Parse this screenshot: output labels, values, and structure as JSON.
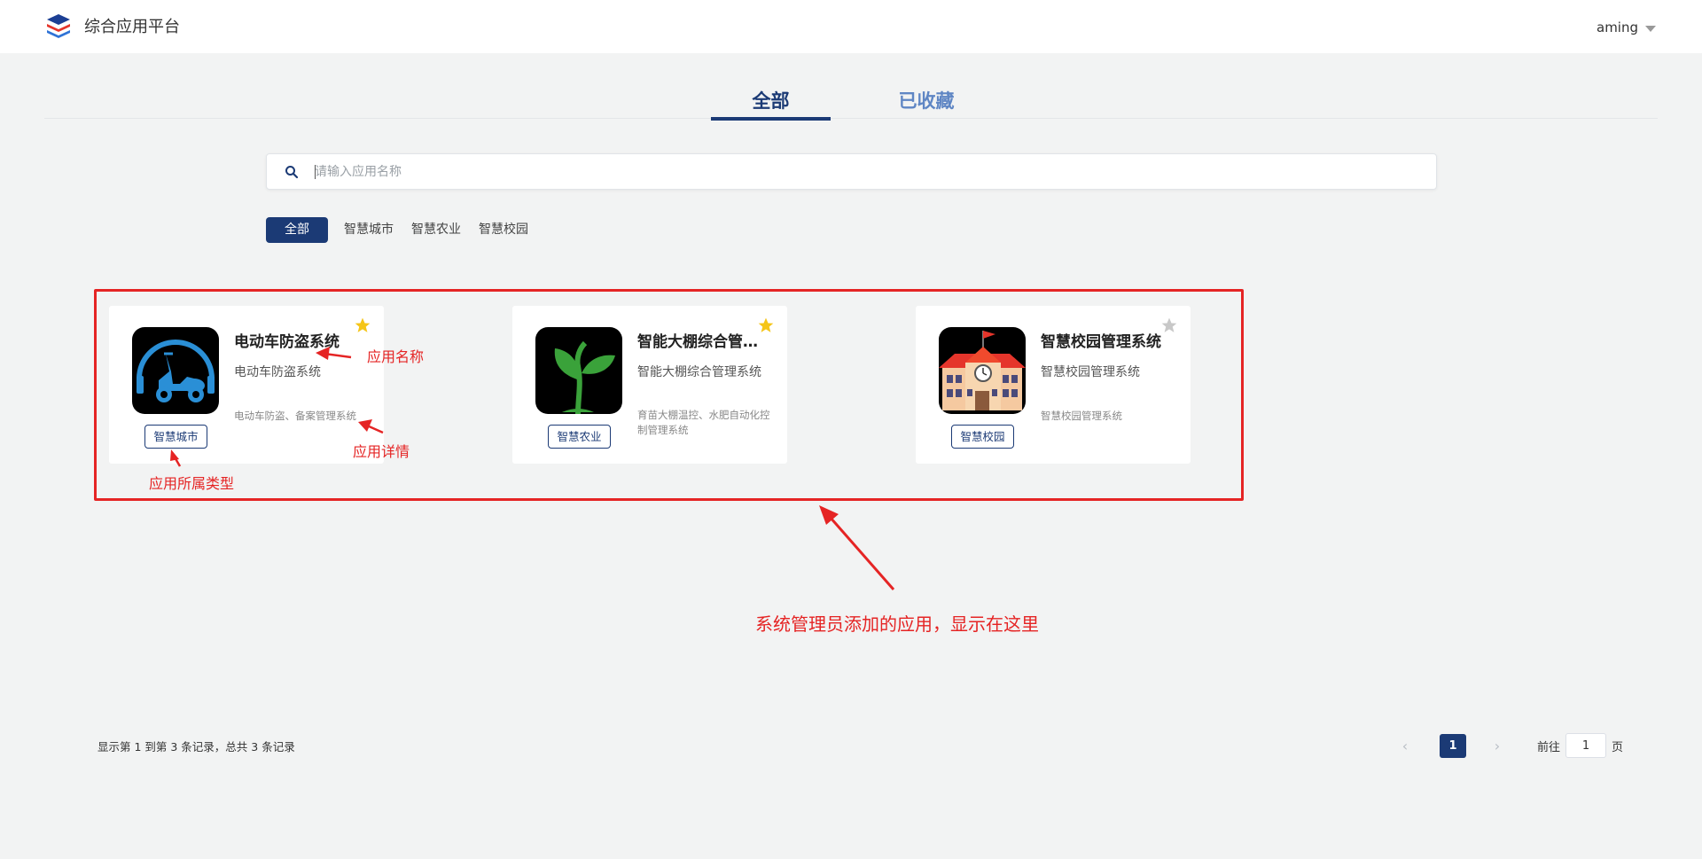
{
  "header": {
    "title": "综合应用平台",
    "user": "aming"
  },
  "tabs": [
    {
      "label": "全部",
      "active": true
    },
    {
      "label": "已收藏",
      "active": false
    }
  ],
  "search": {
    "placeholder": "请输入应用名称",
    "value": ""
  },
  "filters": [
    {
      "label": "全部",
      "active": true
    },
    {
      "label": "智慧城市",
      "active": false
    },
    {
      "label": "智慧农业",
      "active": false
    },
    {
      "label": "智慧校园",
      "active": false
    }
  ],
  "apps": [
    {
      "name": "电动车防盗系统",
      "subname": "电动车防盗系统",
      "desc": "电动车防盗、备案管理系统",
      "tag": "智慧城市",
      "favorited": true,
      "icon": "electric-scooter-icon"
    },
    {
      "name": "智能大棚综合管理系统",
      "subname": "智能大棚综合管理系统",
      "desc": "育苗大棚温控、水肥自动化控制管理系统",
      "tag": "智慧农业",
      "favorited": true,
      "icon": "seedling-icon"
    },
    {
      "name": "智慧校园管理系统",
      "subname": "智慧校园管理系统",
      "desc": "智慧校园管理系统",
      "tag": "智慧校园",
      "favorited": false,
      "icon": "school-building-icon"
    }
  ],
  "annotations": {
    "app_name": "应用名称",
    "app_detail": "应用详情",
    "app_type": "应用所属类型",
    "main_note": "系统管理员添加的应用，显示在这里",
    "color": "#e52424"
  },
  "footer": {
    "records": "显示第 1 到第 3 条记录，总共 3 条记录",
    "current_page": "1",
    "goto_label": "前往",
    "goto_value": "1",
    "page_unit": "页"
  },
  "colors": {
    "primary": "#1b3a75",
    "star_active": "#f5c518",
    "star_inactive": "#c8c8c8",
    "background": "#f2f3f3"
  }
}
